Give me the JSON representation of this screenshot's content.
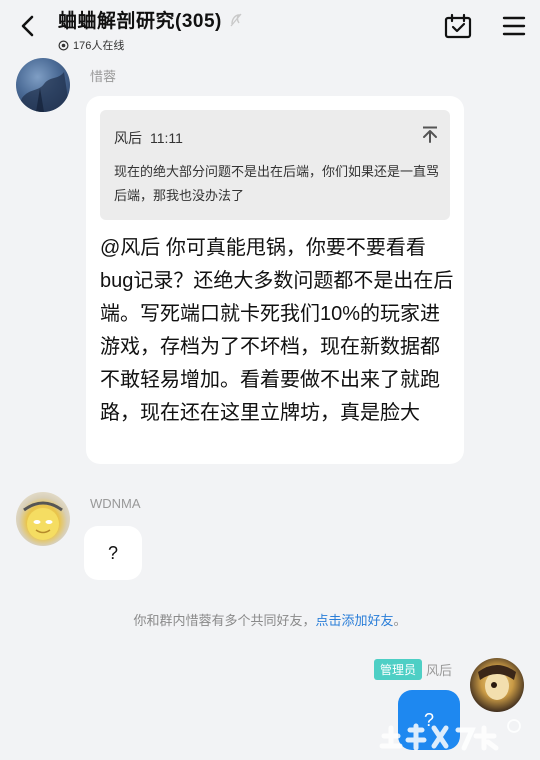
{
  "header": {
    "title": "蛐蛐解剖研究(305)",
    "online": "176人在线"
  },
  "messages": {
    "m1": {
      "sender": "惜蓉",
      "quote_author": "风后",
      "quote_time": "11:11",
      "quote_text": "现在的绝大部分问题不是出在后端，你们如果还是一直骂后端，那我也没办法了",
      "text": "@风后 你可真能甩锅，你要不要看看bug记录？还绝大多数问题都不是出在后端。写死端口就卡死我们10%的玩家进游戏，存档为了不坏档，现在新数据都不敢轻易增加。看着要做不出来了就跑路，现在还在这里立牌坊，真是脸大"
    },
    "m2": {
      "sender": "WDNMA",
      "text": "?"
    },
    "m3": {
      "sender": "风后",
      "role": "管理员",
      "text": "?"
    }
  },
  "notice": {
    "text": "你和群内惜蓉有多个共同好友，",
    "link": "点击添加好友",
    "suffix": "。"
  },
  "colors": {
    "bubble_self": "#1e88f0",
    "admin_tag": "#4ecfc5",
    "link": "#2a7ed8"
  },
  "icons": {
    "back": "chevron-left-icon",
    "mute": "mute-icon",
    "calendar": "calendar-check-icon",
    "menu": "menu-icon",
    "jump": "jump-to-top-icon"
  }
}
